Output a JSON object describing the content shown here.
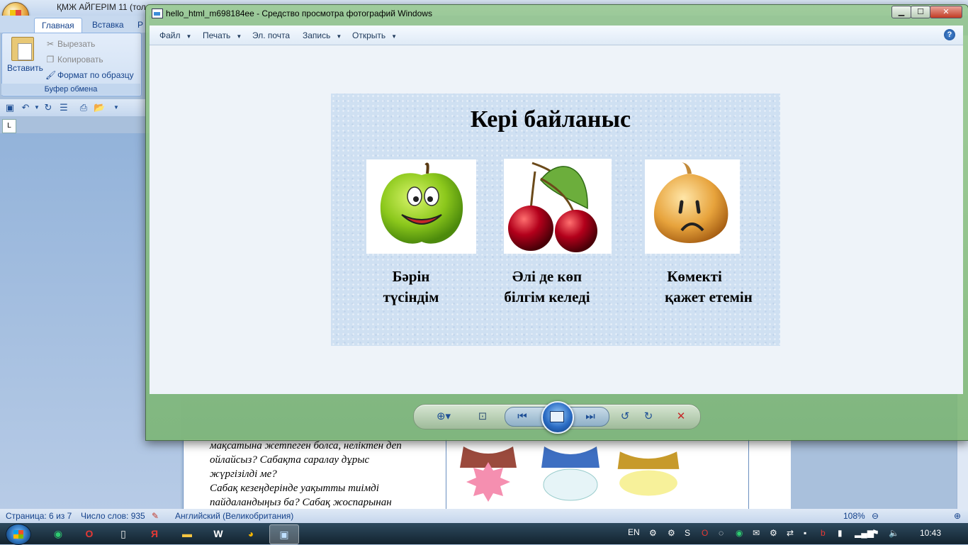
{
  "word": {
    "title": "ҚМЖ АЙГЕРІМ 11 (тол",
    "tabs": [
      "Главная",
      "Вставка",
      "Р"
    ],
    "clipboard": {
      "paste": "Вставить",
      "cut": "Вырезать",
      "copy": "Копировать",
      "format_painter": "Формат по образцу",
      "group_label": "Буфер обмена"
    },
    "doc_text": [
      "мақсатына жетпеген болса, неліктен деп",
      "ойлайсыз? Сабақта саралау дұрыс",
      "жүргізілді ме?",
      "Сабақ кезеңдерінде уақытты тиімді",
      "пайдаландыңыз ба? Сабақ жоспарынан"
    ],
    "status": {
      "page": "Страница: 6 из 7",
      "words": "Число слов: 935",
      "language": "Английский (Великобритания)",
      "zoom": "108%"
    }
  },
  "viewer": {
    "title": "hello_html_m698184ee - Средство просмотра фотографий Windows",
    "menu": [
      {
        "label": "Файл",
        "caret": true
      },
      {
        "label": "Печать",
        "caret": true
      },
      {
        "label": "Эл. почта",
        "caret": false
      },
      {
        "label": "Запись",
        "caret": true
      },
      {
        "label": "Открыть",
        "caret": true
      }
    ],
    "slide": {
      "title": "Кері байланыс",
      "items": [
        {
          "line1": "Бәрін",
          "line2": "түсіндім",
          "image": "smiling-apple"
        },
        {
          "line1": "Әлі де көп",
          "line2": "білгім келеді",
          "image": "cherries"
        },
        {
          "line1": "Көмекті",
          "line2": "қажет етемін",
          "image": "sad-onion"
        }
      ]
    }
  },
  "taskbar": {
    "lang": "EN",
    "clock": "10:43"
  }
}
